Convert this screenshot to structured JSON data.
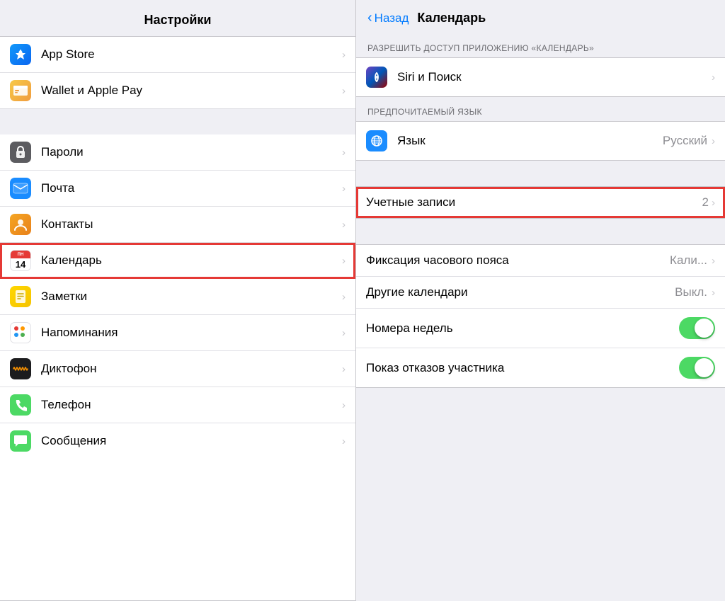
{
  "left": {
    "title": "Настройки",
    "items": [
      {
        "id": "appstore",
        "label": "App Store",
        "icon": "appstore",
        "iconColor": "icon-appstore",
        "iconChar": "🅰"
      },
      {
        "id": "wallet",
        "label": "Wallet и Apple Pay",
        "icon": "wallet",
        "iconColor": "icon-wallet",
        "iconChar": "💳"
      },
      {
        "id": "passwords",
        "label": "Пароли",
        "icon": "passwords",
        "iconColor": "icon-passwords",
        "iconChar": "🔑"
      },
      {
        "id": "mail",
        "label": "Почта",
        "icon": "mail",
        "iconColor": "icon-mail",
        "iconChar": "✉"
      },
      {
        "id": "contacts",
        "label": "Контакты",
        "icon": "contacts",
        "iconColor": "icon-contacts",
        "iconChar": "👤"
      },
      {
        "id": "calendar",
        "label": "Календарь",
        "icon": "calendar",
        "iconColor": "icon-calendar",
        "highlighted": true
      },
      {
        "id": "notes",
        "label": "Заметки",
        "icon": "notes",
        "iconColor": "icon-notes",
        "iconChar": "📝"
      },
      {
        "id": "reminders",
        "label": "Напоминания",
        "icon": "reminders",
        "iconColor": "icon-reminders",
        "iconChar": "🔴"
      },
      {
        "id": "voice",
        "label": "Диктофон",
        "icon": "voice",
        "iconColor": "icon-voice",
        "iconChar": "🎙"
      },
      {
        "id": "phone",
        "label": "Телефон",
        "icon": "phone",
        "iconColor": "icon-phone",
        "iconChar": "📞"
      },
      {
        "id": "messages",
        "label": "Сообщения",
        "icon": "messages",
        "iconColor": "icon-messages",
        "iconChar": "💬"
      }
    ]
  },
  "right": {
    "backLabel": "Назад",
    "title": "Календарь",
    "sections": [
      {
        "header": "РАЗРЕШИТЬ ДОСТУП ПРИЛОЖЕНИЮ «КАЛЕНДАРЬ»",
        "items": [
          {
            "id": "siri",
            "icon": "siri",
            "label": "Siri и Поиск",
            "value": "",
            "badge": "",
            "type": "navigate"
          }
        ]
      },
      {
        "header": "ПРЕДПОЧИТАЕМЫЙ ЯЗЫК",
        "items": [
          {
            "id": "language",
            "icon": "language",
            "label": "Язык",
            "value": "Русский",
            "badge": "",
            "type": "navigate"
          }
        ]
      },
      {
        "header": "",
        "items": [
          {
            "id": "accounts",
            "icon": "",
            "label": "Учетные записи",
            "value": "",
            "badge": "2",
            "type": "navigate",
            "highlighted": true
          }
        ]
      },
      {
        "header": "",
        "items": [
          {
            "id": "timezone",
            "icon": "",
            "label": "Фиксация часового пояса",
            "value": "Кали...",
            "badge": "",
            "type": "navigate"
          },
          {
            "id": "other-calendars",
            "icon": "",
            "label": "Другие календари",
            "value": "Выкл.",
            "badge": "",
            "type": "navigate"
          },
          {
            "id": "week-numbers",
            "icon": "",
            "label": "Номера недель",
            "value": "",
            "badge": "",
            "type": "toggle",
            "toggleOn": true
          },
          {
            "id": "decline-invites",
            "icon": "",
            "label": "Показ отказов участника",
            "value": "",
            "badge": "",
            "type": "toggle",
            "toggleOn": true
          }
        ]
      }
    ]
  }
}
